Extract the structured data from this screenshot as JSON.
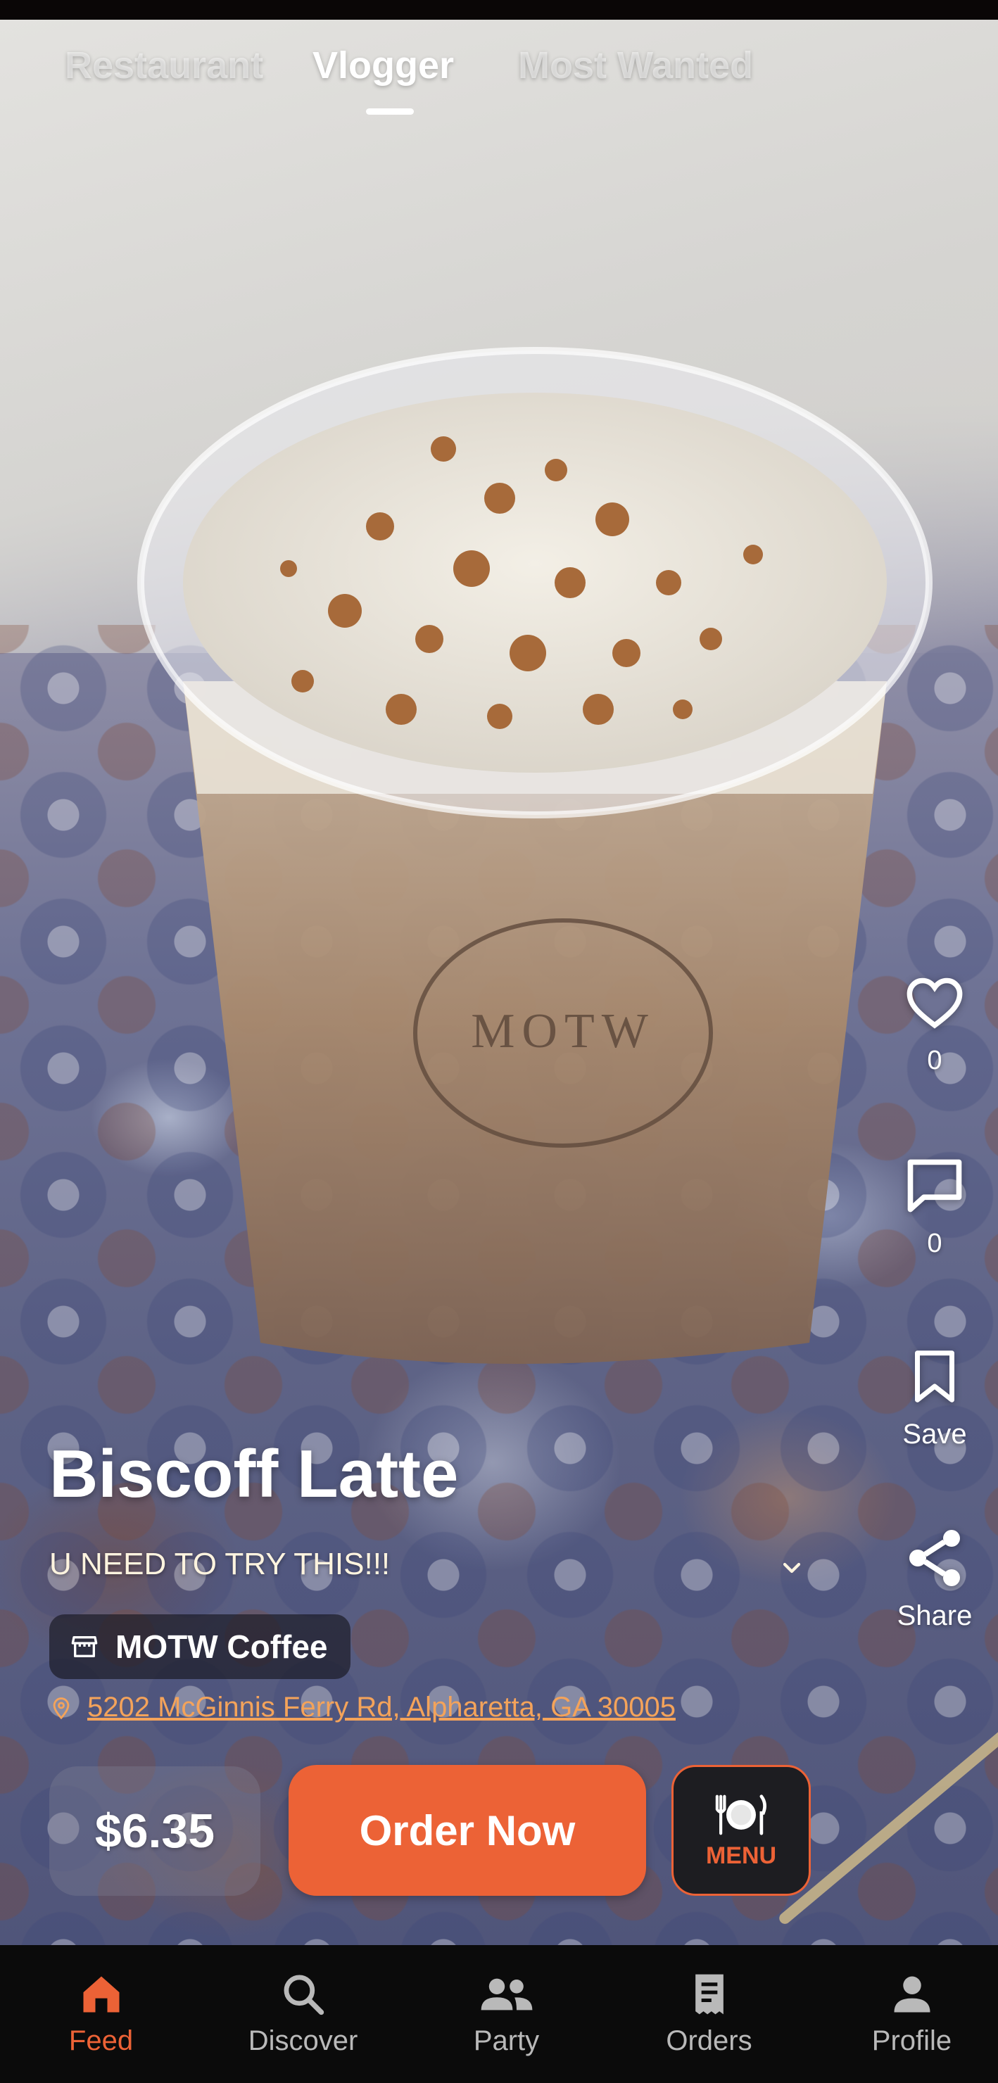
{
  "top_tabs": [
    {
      "label": "Restaurant",
      "active": false
    },
    {
      "label": "Vlogger",
      "active": true
    },
    {
      "label": "Most Wanted",
      "active": false
    }
  ],
  "post": {
    "title": "Biscoff Latte",
    "caption": "U NEED TO TRY THIS!!!",
    "cup_branding": "MOTW",
    "shop": {
      "name": "MOTW Coffee"
    },
    "address": "5202 McGinnis Ferry Rd, Alpharetta, GA 30005"
  },
  "rail": {
    "likes": {
      "icon": "heart-icon",
      "count": "0"
    },
    "comments": {
      "icon": "comment-icon",
      "count": "0"
    },
    "save": {
      "icon": "bookmark-icon",
      "label": "Save"
    },
    "share": {
      "icon": "share-icon",
      "label": "Share"
    }
  },
  "actions": {
    "price": "$6.35",
    "order_label": "Order Now",
    "menu_label": "MENU"
  },
  "bottom_nav": [
    {
      "label": "Feed",
      "icon": "home-icon",
      "active": true
    },
    {
      "label": "Discover",
      "icon": "search-icon",
      "active": false
    },
    {
      "label": "Party",
      "icon": "people-icon",
      "active": false
    },
    {
      "label": "Orders",
      "icon": "receipt-icon",
      "active": false
    },
    {
      "label": "Profile",
      "icon": "person-icon",
      "active": false
    }
  ],
  "colors": {
    "accent": "#ec6236",
    "address": "#f4a35a",
    "nav_background": "#0b0b0b",
    "nav_inactive": "#b9b9b9"
  }
}
